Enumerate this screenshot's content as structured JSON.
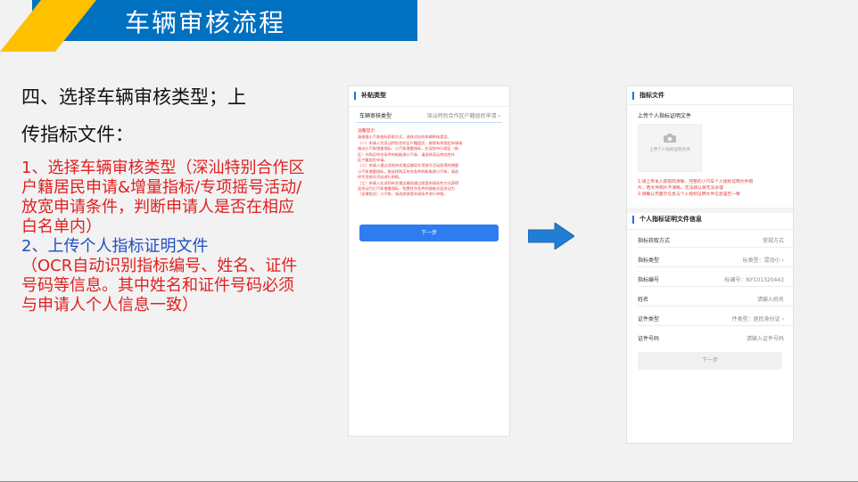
{
  "header": {
    "title": "车辆审核流程",
    "colors": {
      "blue": "#0070c0",
      "yellow": "#ffc000"
    }
  },
  "heading": {
    "line1": "四、选择车辆审核类型；上",
    "line2": "传指标文件："
  },
  "description": {
    "item1_red": "1、选择车辆审核类型（深汕特别合作区户籍居民申请&增量指标/专项摇号活动/放宽申请条件，判断申请人是否在相应白名单内）",
    "item2_blue": "2、上传个人指标证明文件",
    "item2_red": "（OCR自动识别指标编号、姓名、证件号码等信息。其中姓名和证件号码必须与申请人个人信息一致）"
  },
  "left_phone": {
    "section_title": "补贴类型",
    "type_label": "车辆审核类型",
    "type_value": "深汕特别合作区户籍居民申请",
    "tip_heading": "温馨提示:",
    "tip_lines": [
      "请根据小汽车指标获取方式，选择对应的车辆审核类型。",
      "（一）申请人为深汕特别合作区户籍居民，按照有关规定申请纯",
      "电动小汽车增量指标：小汽车增量指标，在深圳市行政区（新",
      "区）内购买符合条件的新能源小汽车，请选择深汕特别合作",
      "区户籍居民申请。",
      "（二）申请人通过深圳市交通运输局专项摇号活动获得的增量",
      "小汽车增量指标，按选择购买符合条件的新能源小汽车，请选",
      "择专项摇号活动进行申报。",
      "（三）申请人在深圳市交通运输局通过放宽申请条件方式获得",
      "混合动力小汽车增量指标，购置符合条件的插电式混合动力",
      "（含增程式）小汽车，请选择放宽申请条件进行申报。"
    ],
    "next_button": "下一步"
  },
  "right_phone": {
    "section_title": "指标文件",
    "upload_label": "上传个人指标证明文件",
    "upload_box_text": "上传个人指标证明文件",
    "red_notes": [
      "1.请上传本人获取的清晰、完整的小汽车个人指标证明文件照",
      "片，若文件照片不清晰、无法辨认将无法办理",
      "2.请确认页面示信息与个人指标证明文件信息是否一致"
    ],
    "info_title": "个人指标证明文件信息",
    "fields": [
      {
        "label": "指标获取方式",
        "value": "常规方式",
        "arrow": false
      },
      {
        "label": "指标类型",
        "value": "标类型：混动小",
        "arrow": true
      },
      {
        "label": "指标编号",
        "value": "标编号：NY101320443",
        "arrow": false
      },
      {
        "label": "姓名",
        "value": "请输入姓名",
        "arrow": false
      },
      {
        "label": "证件类型",
        "value": "件类型：居民身份证",
        "arrow": true
      },
      {
        "label": "证件号码",
        "value": "请输入证件号码",
        "arrow": false
      }
    ],
    "next_button": "下一步"
  },
  "arrow_icon": "right-arrow-icon",
  "accent_color": "#2e7df0"
}
